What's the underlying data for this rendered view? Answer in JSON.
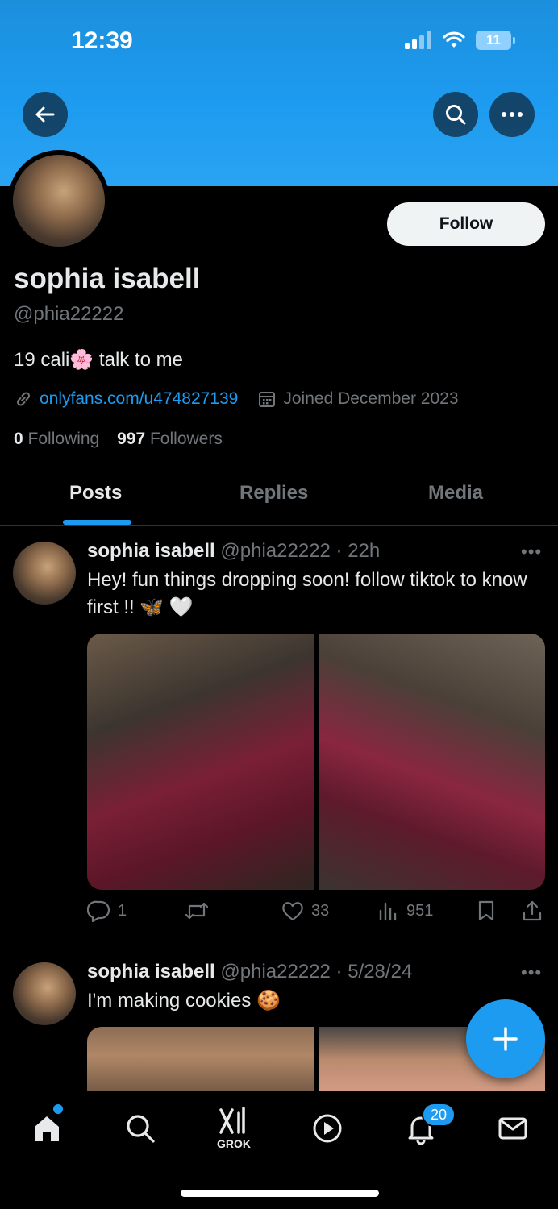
{
  "status": {
    "time": "12:39",
    "battery": "11"
  },
  "profile": {
    "display_name": "sophia isabell",
    "handle": "@phia22222",
    "follow_label": "Follow",
    "bio": "19 cali🌸 talk to me",
    "link": "onlyfans.com/u474827139",
    "joined": "Joined December 2023",
    "following_count": "0",
    "following_label": "Following",
    "followers_count": "997",
    "followers_label": "Followers"
  },
  "tabs": [
    {
      "label": "Posts",
      "active": true
    },
    {
      "label": "Replies",
      "active": false
    },
    {
      "label": "Media",
      "active": false
    }
  ],
  "posts": [
    {
      "name": "sophia isabell",
      "handle_time": "@phia22222 · 22h",
      "text": "Hey! fun things dropping soon! follow tiktok to know first !! 🦋 🤍",
      "replies": "1",
      "reposts": "",
      "likes": "33",
      "views": "951"
    },
    {
      "name": "sophia isabell",
      "handle_time": "@phia22222 · 5/28/24",
      "text": "I'm making cookies 🍪"
    }
  ],
  "nav": {
    "grok_label": "GROK",
    "notifications_badge": "20"
  },
  "colors": {
    "accent": "#1d9bf0",
    "banner": "#1d9bf0"
  },
  "icons": [
    "back-arrow-icon",
    "search-icon",
    "more-icon",
    "link-icon",
    "calendar-icon",
    "reply-icon",
    "repost-icon",
    "like-icon",
    "views-icon",
    "bookmark-icon",
    "share-icon",
    "compose-plus-icon",
    "home-icon",
    "explore-icon",
    "grok-icon",
    "video-icon",
    "bell-icon",
    "mail-icon"
  ]
}
